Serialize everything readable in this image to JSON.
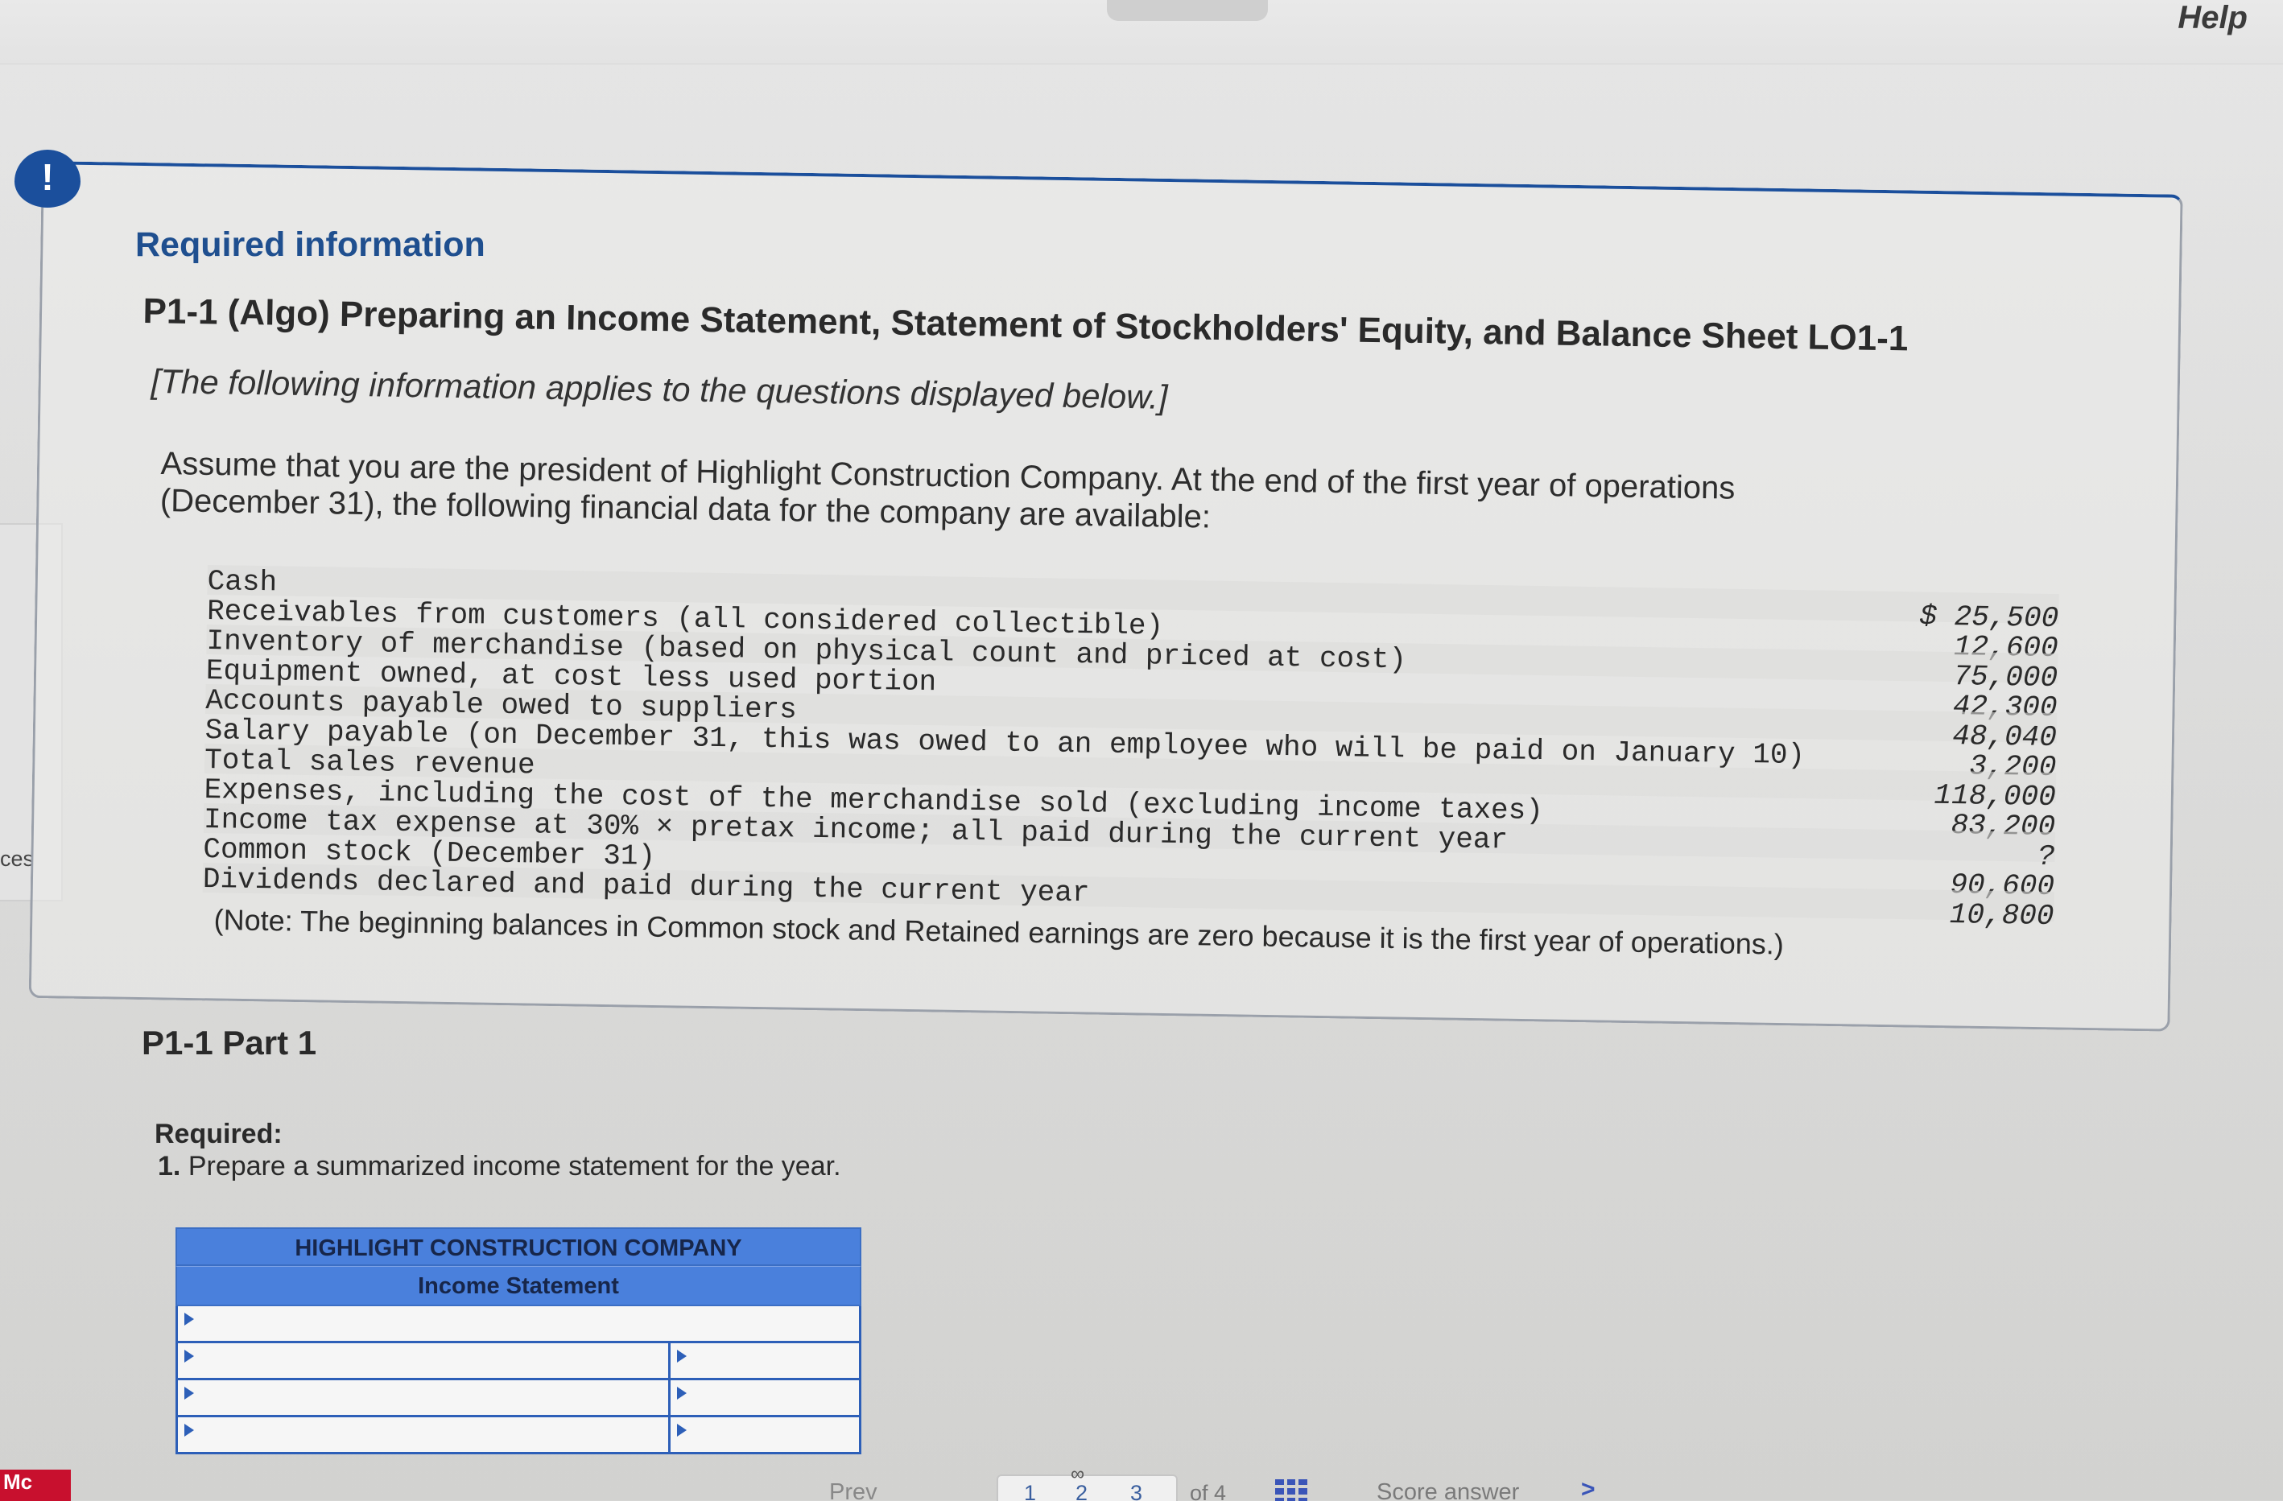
{
  "header": {
    "help_label": "Help"
  },
  "sidebar": {
    "edge_label": "ces"
  },
  "alert": {
    "icon_glyph": "!"
  },
  "info": {
    "heading": "Required information",
    "problem_title": "P1-1 (Algo) Preparing an Income Statement, Statement of Stockholders' Equity, and Balance Sheet LO1-1",
    "applies_note": "[The following information applies to the questions displayed below.]",
    "intro_line1": "Assume that you are the president of Highlight Construction Company. At the end of the first year of operations",
    "intro_line2": "(December 31), the following financial data for the company are available:",
    "items": [
      {
        "label": "Cash",
        "value": "$ 25,500"
      },
      {
        "label": "Receivables from customers (all considered collectible)",
        "value": "12,600"
      },
      {
        "label": "Inventory of merchandise (based on physical count and priced at cost)",
        "value": "75,000"
      },
      {
        "label": "Equipment owned, at cost less used portion",
        "value": "42,300"
      },
      {
        "label": "Accounts payable owed to suppliers",
        "value": "48,040"
      },
      {
        "label": "Salary payable (on December 31, this was owed to an employee who will be paid on January 10)",
        "value": "3,200"
      },
      {
        "label": "Total sales revenue",
        "value": "118,000"
      },
      {
        "label": "Expenses, including the cost of the merchandise sold (excluding income taxes)",
        "value": "83,200"
      },
      {
        "label": "Income tax expense at 30% × pretax income; all paid during the current year",
        "value": "?"
      },
      {
        "label": "Common stock (December 31)",
        "value": "90,600"
      },
      {
        "label": "Dividends declared and paid during the current year",
        "value": "10,800"
      }
    ],
    "note": "(Note: The beginning balances in Common stock and Retained earnings are zero because it is the first year of operations.)"
  },
  "part": {
    "title": "P1-1 Part 1",
    "required_label": "Required:",
    "required_number": "1.",
    "required_text": "Prepare a summarized income statement for the year."
  },
  "statement": {
    "company": "HIGHLIGHT CONSTRUCTION COMPANY",
    "title": "Income Statement"
  },
  "footer": {
    "brand": "Mc",
    "prev_label": "Prev",
    "pages": [
      "1",
      "2",
      "3"
    ],
    "of_total": "of 4",
    "score_label": "Score answer",
    "next_glyph": ">",
    "link_glyph": "∞"
  }
}
